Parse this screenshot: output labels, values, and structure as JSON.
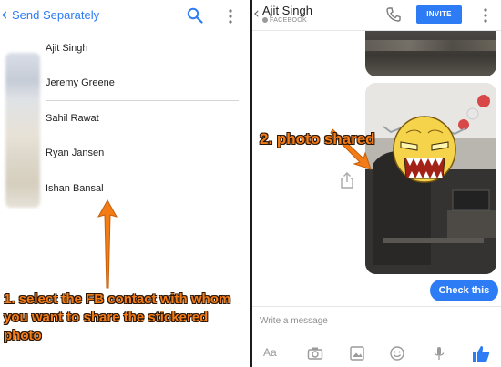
{
  "left_panel": {
    "header": {
      "back_glyph": "‹",
      "title": "Send Separately",
      "icons": [
        "search-icon",
        "more-vertical-icon"
      ]
    },
    "contacts": [
      {
        "name": "Ajit Singh"
      },
      {
        "name": "Jeremy Greene"
      },
      {
        "name": "Sahil Rawat"
      },
      {
        "name": "Ryan Jansen"
      },
      {
        "name": "Ishan Bansal"
      }
    ],
    "annotation": "1. select the FB contact with whom you want to share the stickered photo"
  },
  "right_panel": {
    "header": {
      "back_glyph": "‹",
      "contact_name": "Ajit Singh",
      "subtitle": "FACEBOOK",
      "invite_label": "INVITE",
      "icons": [
        "phone-icon",
        "more-vertical-icon"
      ]
    },
    "annotation": "2. photo shared",
    "message_bubble": "Check this",
    "compose": {
      "placeholder": "Write a message",
      "aa_label": "Aa",
      "tools": [
        "text-format-icon",
        "camera-icon",
        "gallery-icon",
        "emoji-icon",
        "microphone-icon",
        "like-icon"
      ]
    }
  },
  "colors": {
    "accent_blue": "#2d7cf6",
    "annotation_orange": "#f47c17",
    "annotation_outline": "#2a1606",
    "sticker_yellow": "#f5d34a"
  }
}
